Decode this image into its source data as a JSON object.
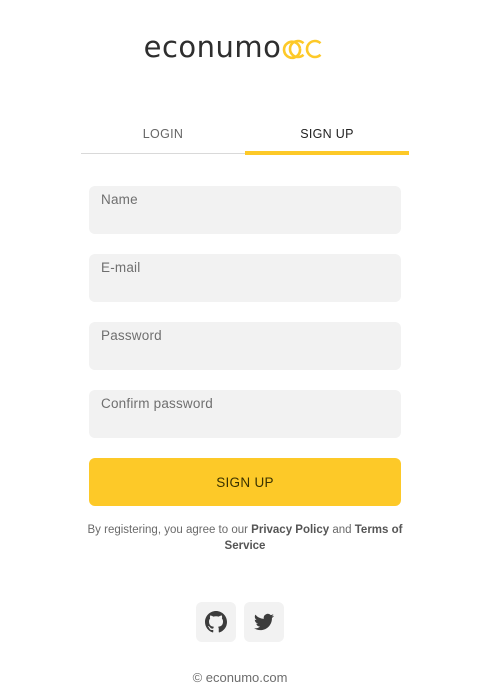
{
  "brand": {
    "name": "econumo",
    "accent_color": "#fdc928"
  },
  "tabs": [
    {
      "label": "LOGIN",
      "active": false
    },
    {
      "label": "SIGN UP",
      "active": true
    }
  ],
  "form": {
    "name": {
      "label": "Name",
      "value": ""
    },
    "email": {
      "label": "E-mail",
      "value": ""
    },
    "password": {
      "label": "Password",
      "value": ""
    },
    "confirm_password": {
      "label": "Confirm password",
      "value": ""
    },
    "submit_label": "SIGN UP"
  },
  "terms": {
    "prefix": "By registering, you agree to our ",
    "privacy_link": "Privacy Policy",
    "middle": " and ",
    "terms_link": "Terms of Service"
  },
  "social": [
    {
      "icon": "github-icon"
    },
    {
      "icon": "twitter-icon"
    }
  ],
  "footer": {
    "text": "© econumo.com"
  }
}
